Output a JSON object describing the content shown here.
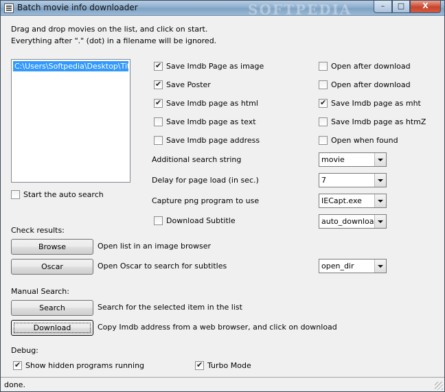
{
  "window": {
    "title": "Batch movie info downloader",
    "watermark": "SOFTPEDIA",
    "minimize": "–",
    "maximize": "□",
    "close": "X"
  },
  "instructions": {
    "line1": "Drag and drop movies on the list, and click on start.",
    "line2": "Everything after \".\" (dot) in a filename will be ignored."
  },
  "movie_list": {
    "items": [
      "C:\\Users\\Softpedia\\Desktop\\Titanic"
    ]
  },
  "options_left": [
    {
      "label": "Save Imdb Page as image",
      "checked": true
    },
    {
      "label": "Save Poster",
      "checked": true
    },
    {
      "label": "Save Imdb page as html",
      "checked": true
    },
    {
      "label": "Save Imdb page as text",
      "checked": false
    },
    {
      "label": "Save Imdb page address",
      "checked": false
    }
  ],
  "options_right": [
    {
      "label": "Open after download",
      "checked": false
    },
    {
      "label": "Open after download",
      "checked": false
    },
    {
      "label": "Save Imdb page as mht",
      "checked": true
    },
    {
      "label": "Save Imdb page as htmZ",
      "checked": false
    },
    {
      "label": "Open when found",
      "checked": false
    }
  ],
  "settings": {
    "search_string_label": "Additional search string",
    "search_string_value": "movie",
    "delay_label": "Delay for page load (in sec.)",
    "delay_value": "7",
    "capture_label": "Capture png program to use",
    "capture_value": "IECapt.exe",
    "subtitle_label": "Download Subtitle",
    "subtitle_checked": false,
    "subtitle_value": "auto_download"
  },
  "auto_search": {
    "label": "Start the auto search",
    "checked": false
  },
  "check_results": {
    "heading": "Check results:",
    "browse_label": "Browse",
    "browse_desc": "Open list in an image browser",
    "oscar_label": "Oscar",
    "oscar_desc": "Open Oscar to search for subtitles",
    "oscar_value": "open_dir"
  },
  "manual_search": {
    "heading": "Manual Search:",
    "search_label": "Search",
    "search_desc": "Search for the selected item in the list",
    "download_label": "Download",
    "download_desc": "Copy Imdb address from a web browser, and click on download"
  },
  "debug": {
    "heading": "Debug:",
    "hidden_label": "Show hidden programs running",
    "hidden_checked": true,
    "turbo_label": "Turbo Mode",
    "turbo_checked": true
  },
  "status": {
    "text": "done."
  }
}
